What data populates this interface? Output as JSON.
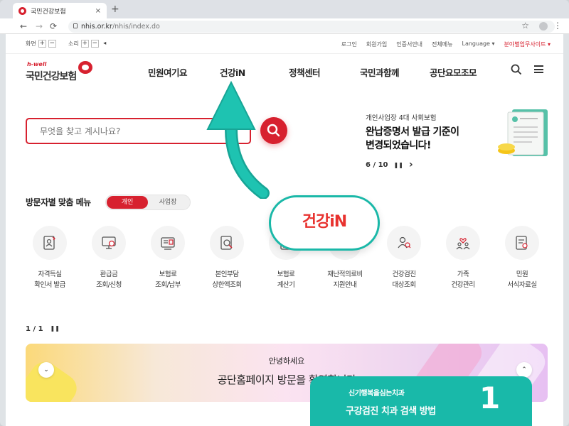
{
  "browser": {
    "tab_title": "국민건강보험",
    "url_host": "nhis.or.kr",
    "url_path": "/nhis/index.do",
    "new_tab": "+",
    "close": "×",
    "back": "←",
    "forward": "→",
    "reload": "⟳",
    "star": "☆",
    "kebab": "⋮"
  },
  "util": {
    "screen_label": "화면",
    "sound_label": "소리",
    "plus": "+",
    "minus": "−",
    "links": [
      "로그인",
      "회원가입",
      "인증서안내",
      "전체메뉴",
      "Language ▾",
      "분야별업무사이트 ▾"
    ]
  },
  "header": {
    "logo_tag": "h-well",
    "logo_name": "국민건강보험",
    "menu": [
      "민원여기요",
      "건강iN",
      "정책센터",
      "국민과함께",
      "공단요모조모"
    ]
  },
  "search": {
    "placeholder": "무엇을 찾고 계시나요?"
  },
  "notice": {
    "kicker": "개인사업장 4대 사회보험",
    "headline_1": "완납증명서 발급 기준이",
    "headline_2": "변경되었습니다!",
    "pager": "6 / 10",
    "pause": "❚❚",
    "prev": "‹",
    "next": "›"
  },
  "custom_menu": {
    "title": "방문자별 맞춤 메뉴",
    "tab_on": "개인",
    "tab_off": "사업장"
  },
  "quick_menu": [
    {
      "label": "자격득실\n확인서 발급",
      "icon": "id-card-icon"
    },
    {
      "label": "환급금\n조회/신청",
      "icon": "monitor-won-icon"
    },
    {
      "label": "보험료\n조회/납부",
      "icon": "receipt-icon"
    },
    {
      "label": "본인부담\n상한액조회",
      "icon": "search-doc-icon"
    },
    {
      "label": "보험료\n계산기",
      "icon": "calculator-icon"
    },
    {
      "label": "재난적의료비\n지원안내",
      "icon": "medical-icon"
    },
    {
      "label": "건강검진\n대상조회",
      "icon": "people-search-icon"
    },
    {
      "label": "가족\n건강관리",
      "icon": "family-heart-icon"
    },
    {
      "label": "민원\n서식자료실",
      "icon": "form-icon"
    }
  ],
  "pager2": {
    "text": "1 / 1",
    "pause": "❚❚"
  },
  "banner": {
    "greet": "안녕하세요",
    "welcome": "공단홈페이지 방문을 환영합니다",
    "down": "⌄",
    "up": "⌃"
  },
  "overlay": {
    "badge": "건강iN",
    "caption_1": "신기행복을심는치과",
    "caption_2": "구강검진 치과 검색 방법",
    "step": "1"
  },
  "colors": {
    "brand": "#d7212f",
    "teal": "#19b9a9"
  }
}
